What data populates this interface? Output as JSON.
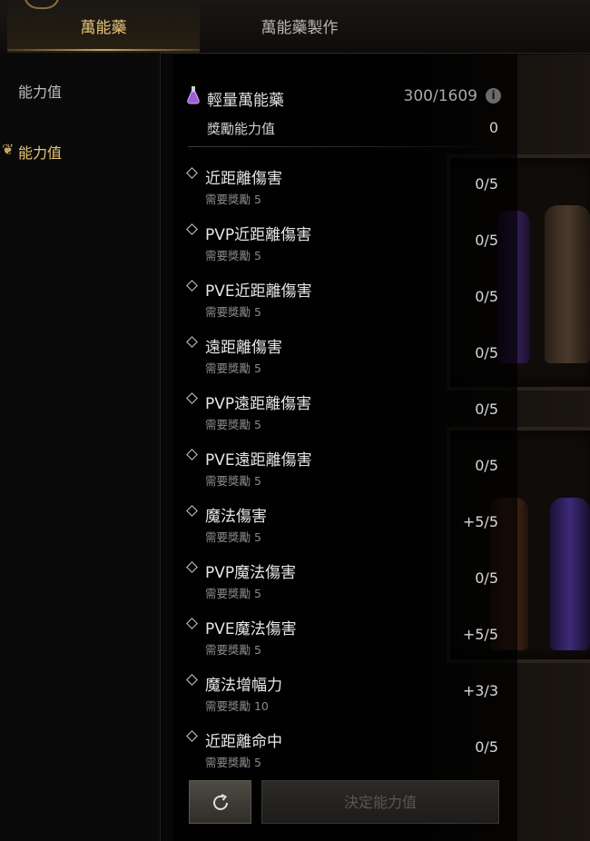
{
  "tabs": [
    {
      "label": "萬能藥"
    },
    {
      "label": "萬能藥製作"
    }
  ],
  "sidebar": {
    "items": [
      {
        "label": "能力值"
      },
      {
        "label": "能力值"
      }
    ]
  },
  "potion": {
    "name": "輕量萬能藥",
    "count": "300/1609"
  },
  "reward": {
    "label": "獎勵能力值",
    "value": "0"
  },
  "stats": [
    {
      "name": "近距離傷害",
      "req": "需要獎勵  5",
      "value": "0/5"
    },
    {
      "name": "PVP近距離傷害",
      "req": "需要獎勵  5",
      "value": "0/5"
    },
    {
      "name": "PVE近距離傷害",
      "req": "需要獎勵  5",
      "value": "0/5"
    },
    {
      "name": "遠距離傷害",
      "req": "需要獎勵  5",
      "value": "0/5"
    },
    {
      "name": "PVP遠距離傷害",
      "req": "需要獎勵  5",
      "value": "0/5"
    },
    {
      "name": "PVE遠距離傷害",
      "req": "需要獎勵  5",
      "value": "0/5"
    },
    {
      "name": "魔法傷害",
      "req": "需要獎勵  5",
      "value": "+5/5"
    },
    {
      "name": "PVP魔法傷害",
      "req": "需要獎勵  5",
      "value": "0/5"
    },
    {
      "name": "PVE魔法傷害",
      "req": "需要獎勵  5",
      "value": "+5/5"
    },
    {
      "name": "魔法增幅力",
      "req": "需要獎勵  10",
      "value": "+3/3"
    },
    {
      "name": "近距離命中",
      "req": "需要獎勵  5",
      "value": "0/5"
    }
  ],
  "buttons": {
    "confirm_label": "決定能力值"
  },
  "colors": {
    "accent_gold": "#e8c477",
    "background": "#070707",
    "potion_purple": "#9b5fd6"
  }
}
